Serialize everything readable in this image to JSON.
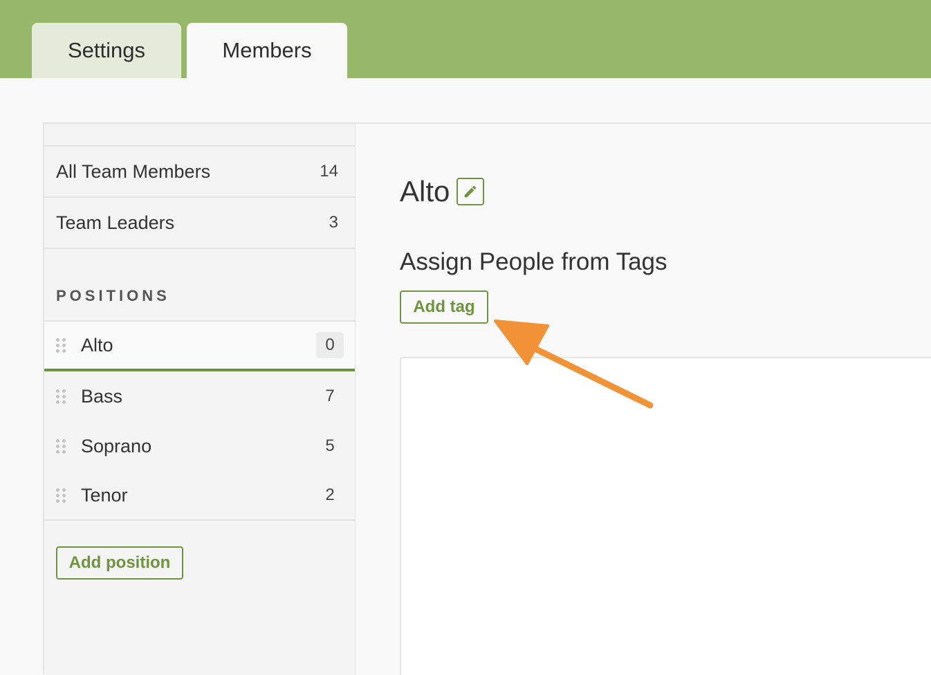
{
  "tabs": [
    {
      "label": "Settings",
      "active": false
    },
    {
      "label": "Members",
      "active": true
    }
  ],
  "sidebar": {
    "groups": [
      {
        "label": "All Team Members",
        "count": "14"
      },
      {
        "label": "Team Leaders",
        "count": "3"
      }
    ],
    "positions_heading": "POSITIONS",
    "positions": [
      {
        "label": "Alto",
        "count": "0",
        "active": true
      },
      {
        "label": "Bass",
        "count": "7",
        "active": false
      },
      {
        "label": "Soprano",
        "count": "5",
        "active": false
      },
      {
        "label": "Tenor",
        "count": "2",
        "active": false
      }
    ],
    "add_position_label": "Add position"
  },
  "main": {
    "title": "Alto",
    "subheading": "Assign People from Tags",
    "add_tag_label": "Add tag"
  },
  "colors": {
    "brand_green": "#97b86a",
    "accent_green": "#6f9440",
    "arrow_orange": "#f19236"
  },
  "icons": {
    "edit": "pencil-icon",
    "drag": "drag-handle-icon",
    "arrow": "arrow-annotation"
  }
}
